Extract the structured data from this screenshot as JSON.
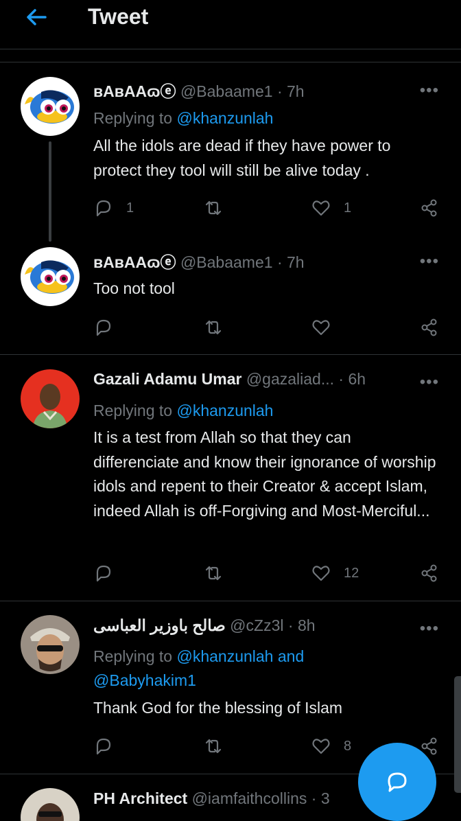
{
  "header": {
    "title": "Tweet"
  },
  "tweets": [
    {
      "name": "ʙAʙAAɷⓔ",
      "handle": "@Babaame1",
      "time": "7h",
      "replying_label": "Replying to ",
      "replying_to": "@khanzunlah",
      "body": "All the idols are dead if they have power to protect they tool will still be alive today .",
      "reply_count": "1",
      "retweet_count": "",
      "like_count": "1"
    },
    {
      "name": "ʙAʙAAɷⓔ",
      "handle": "@Babaame1",
      "time": "7h",
      "body": "Too not tool",
      "reply_count": "",
      "retweet_count": "",
      "like_count": ""
    },
    {
      "name": "Gazali Adamu Umar",
      "handle": "@gazaliad...",
      "time": "6h",
      "replying_label": "Replying to ",
      "replying_to": "@khanzunlah",
      "body": "It is a test from Allah so that they can differenciate and know their ignorance of worship idols and repent to their Creator & accept Islam, indeed Allah is off-Forgiving and Most-Merciful...",
      "reply_count": "",
      "retweet_count": "",
      "like_count": "12"
    },
    {
      "name": "صالح باوزير العباسى",
      "handle": "@cZz3l",
      "time": "8h",
      "replying_label": "Replying to ",
      "replying_to": "@khanzunlah and",
      "replying_to_2": "@Babyhakim1",
      "body": "Thank God for the blessing of Islam",
      "reply_count": "",
      "retweet_count": "",
      "like_count": "8"
    },
    {
      "name": "PH Architect",
      "handle": "@iamfaithcollins",
      "time": "3"
    }
  ],
  "more_glyph": "•••",
  "dot_sep": "·",
  "colors": {
    "accent": "#1d9bf0",
    "background": "#000000",
    "muted": "#71767b",
    "text": "#e7e9ea"
  }
}
